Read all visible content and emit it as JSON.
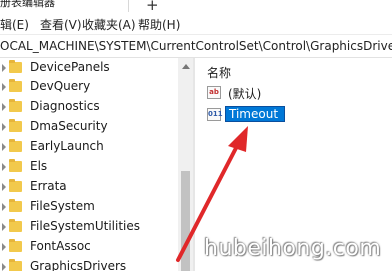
{
  "titlebar": {
    "title": "册表编辑器",
    "new_tab_glyph": "+"
  },
  "menubar": {
    "items": [
      "辑(E)",
      "查看(V)",
      "收藏夹(A)",
      "帮助(H)"
    ]
  },
  "address": {
    "path": "OCAL_MACHINE\\SYSTEM\\CurrentControlSet\\Control\\GraphicsDrivers\\"
  },
  "tree": {
    "items": [
      {
        "label": "DevicePanels"
      },
      {
        "label": "DevQuery"
      },
      {
        "label": "Diagnostics"
      },
      {
        "label": "DmaSecurity"
      },
      {
        "label": "EarlyLaunch"
      },
      {
        "label": "Els"
      },
      {
        "label": "Errata"
      },
      {
        "label": "FileSystem"
      },
      {
        "label": "FileSystemUtilities"
      },
      {
        "label": "FontAssoc"
      },
      {
        "label": "GraphicsDrivers"
      }
    ]
  },
  "values": {
    "column_header": "名称",
    "rows": [
      {
        "name": "(默认)",
        "icon": "string-value-icon",
        "icon_text": "ab"
      },
      {
        "name": "Timeout",
        "icon": "binary-value-icon",
        "icon_text": "011",
        "editing": true
      }
    ]
  },
  "annotation": {
    "color": "#e0282a"
  },
  "watermark": {
    "text": "hubeihong.com"
  }
}
